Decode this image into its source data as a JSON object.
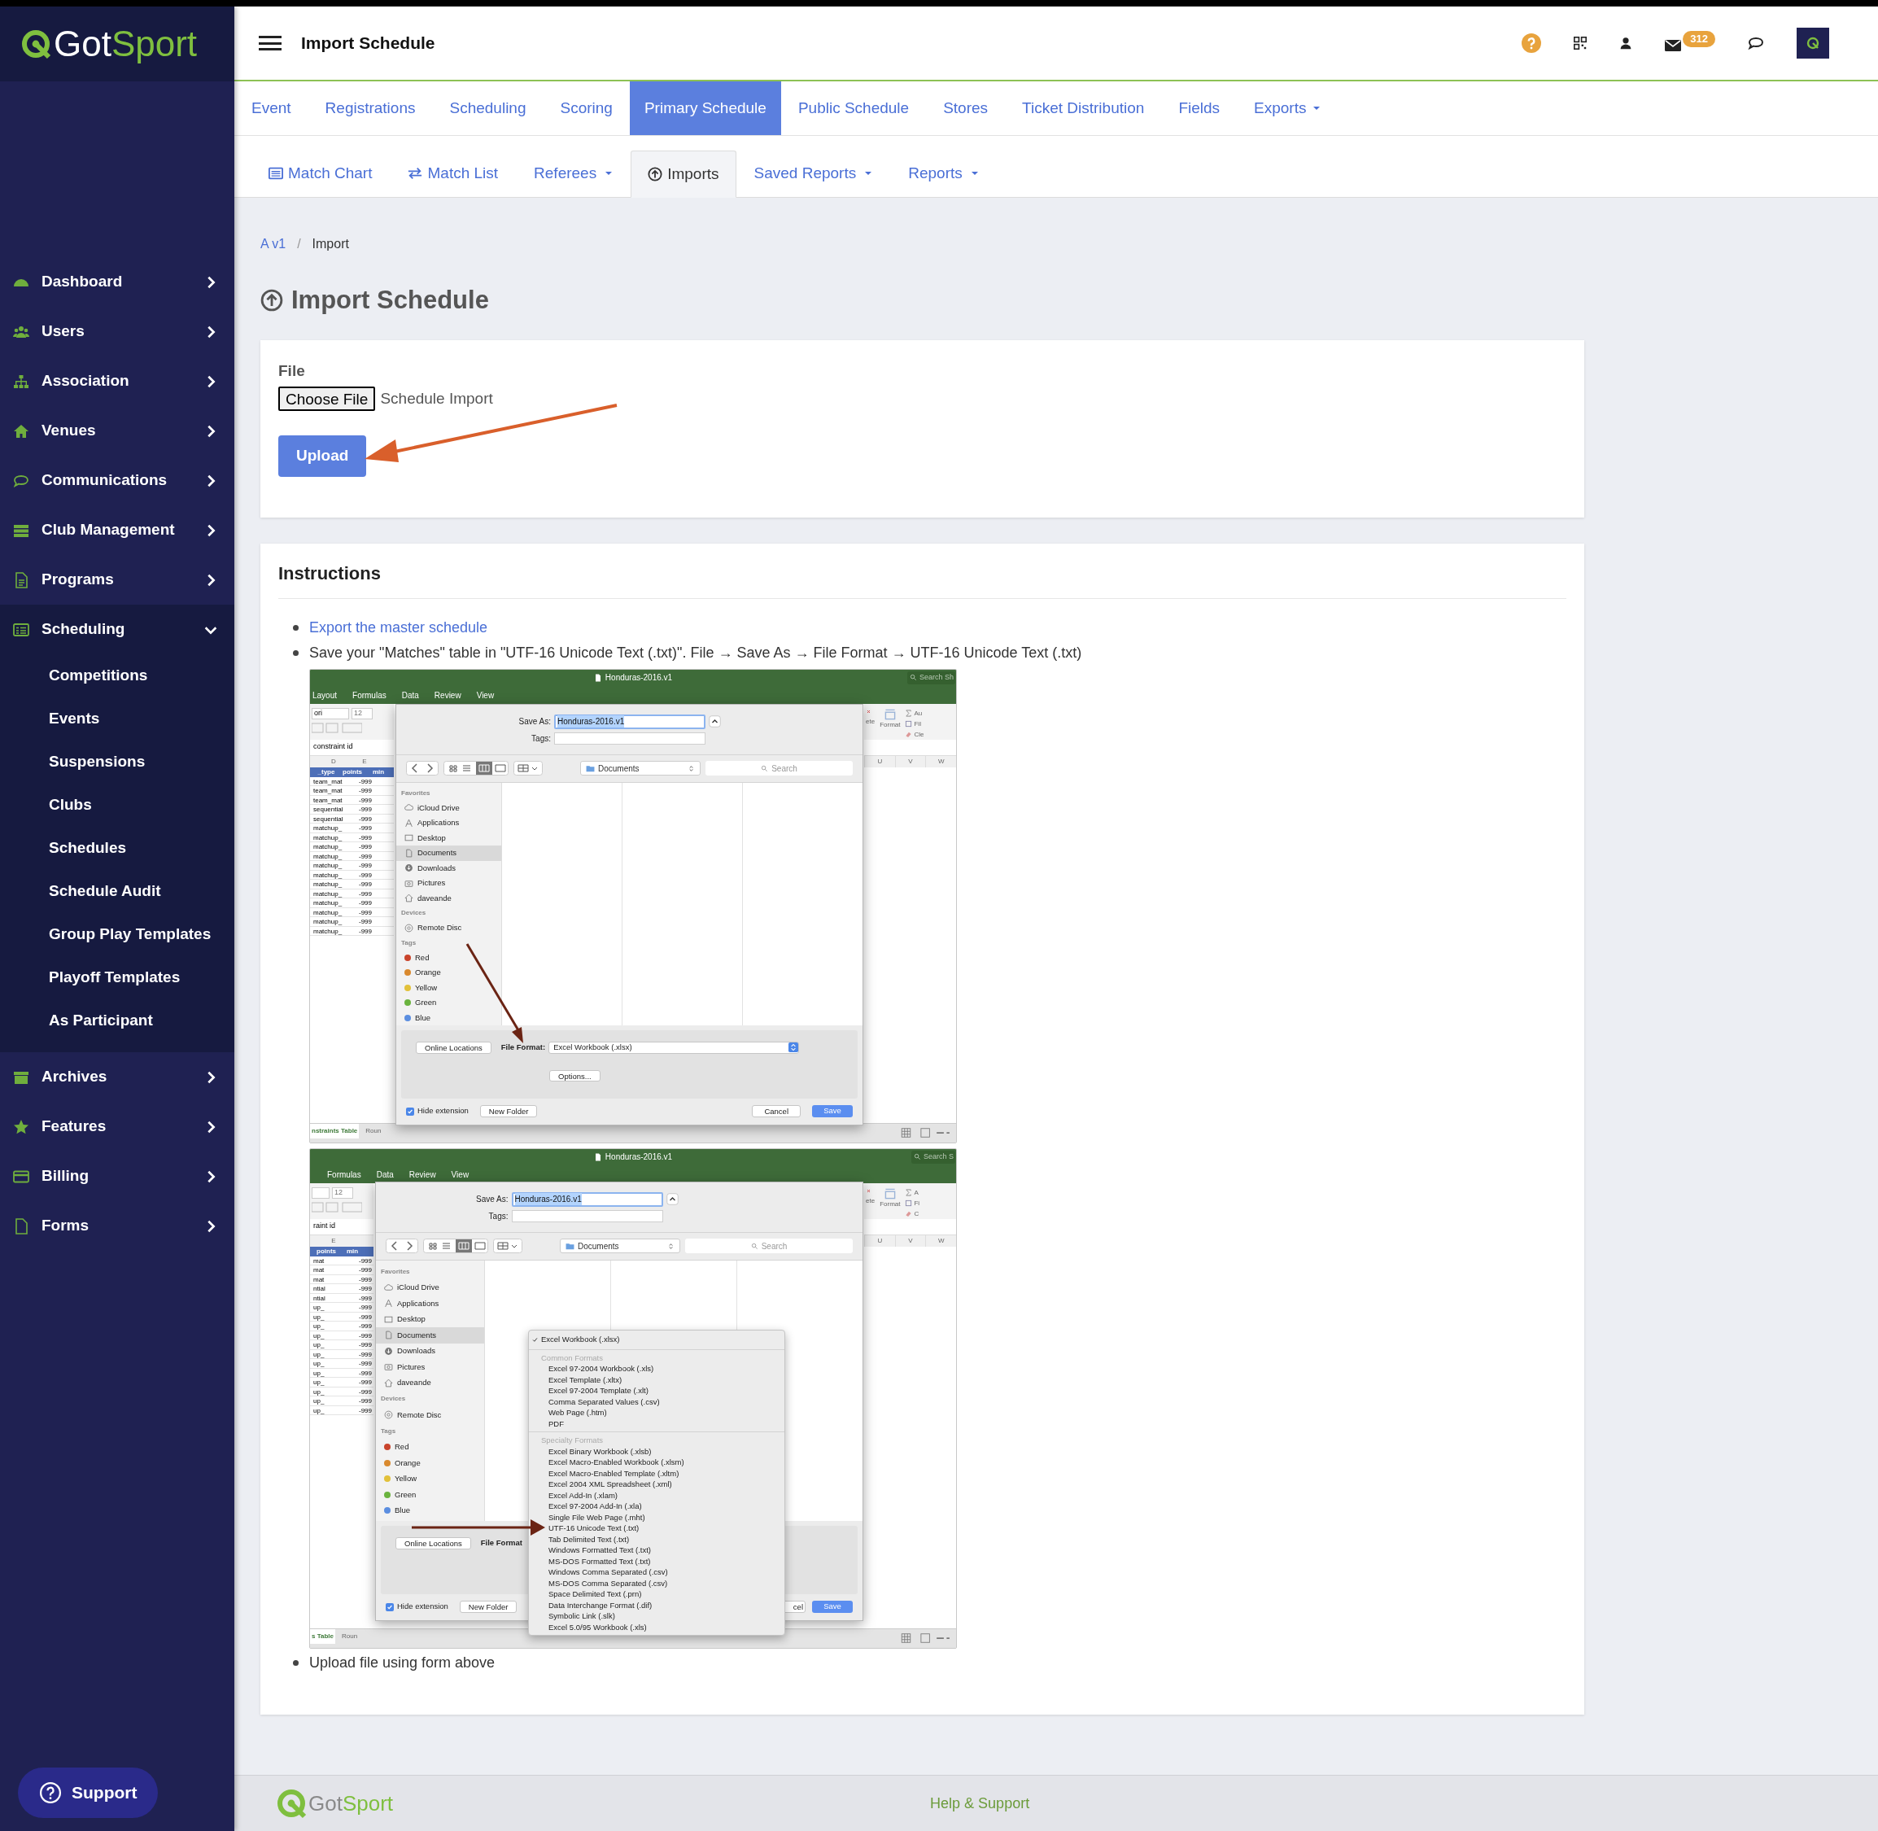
{
  "logo": {
    "part_1": "Got",
    "part_2": "Sport"
  },
  "header": {
    "title": "Import Schedule",
    "mail_count": "312"
  },
  "sidebar": {
    "items": [
      {
        "label": "Dashboard",
        "expanded": false
      },
      {
        "label": "Users",
        "expanded": false
      },
      {
        "label": "Association",
        "expanded": false
      },
      {
        "label": "Venues",
        "expanded": false
      },
      {
        "label": "Communications",
        "expanded": false
      },
      {
        "label": "Club Management",
        "expanded": false
      },
      {
        "label": "Programs",
        "expanded": false
      },
      {
        "label": "Scheduling",
        "expanded": true,
        "children": [
          {
            "label": "Competitions"
          },
          {
            "label": "Events"
          },
          {
            "label": "Suspensions"
          },
          {
            "label": "Clubs"
          },
          {
            "label": "Schedules"
          },
          {
            "label": "Schedule Audit"
          },
          {
            "label": "Group Play Templates"
          },
          {
            "label": "Playoff Templates"
          },
          {
            "label": "As Participant"
          }
        ]
      },
      {
        "label": "Archives",
        "expanded": false
      },
      {
        "label": "Features",
        "expanded": false
      },
      {
        "label": "Billing",
        "expanded": false
      },
      {
        "label": "Forms",
        "expanded": false
      }
    ],
    "support_button": "Support"
  },
  "main_tabs": [
    {
      "label": "Event",
      "selected": false,
      "dropdown": false
    },
    {
      "label": "Registrations",
      "selected": false,
      "dropdown": false
    },
    {
      "label": "Scheduling",
      "selected": false,
      "dropdown": false
    },
    {
      "label": "Scoring",
      "selected": false,
      "dropdown": false
    },
    {
      "label": "Primary Schedule",
      "selected": true,
      "dropdown": false
    },
    {
      "label": "Public Schedule",
      "selected": false,
      "dropdown": false
    },
    {
      "label": "Stores",
      "selected": false,
      "dropdown": false
    },
    {
      "label": "Ticket Distribution",
      "selected": false,
      "dropdown": false
    },
    {
      "label": "Fields",
      "selected": false,
      "dropdown": false
    },
    {
      "label": "Exports",
      "selected": false,
      "dropdown": true
    }
  ],
  "sub_tabs": [
    {
      "label": "Match Chart",
      "selected": false,
      "dropdown": false
    },
    {
      "label": "Match List",
      "selected": false,
      "dropdown": false
    },
    {
      "label": "Referees",
      "selected": false,
      "dropdown": true
    },
    {
      "label": "Imports",
      "selected": true,
      "dropdown": false
    },
    {
      "label": "Saved Reports",
      "selected": false,
      "dropdown": true
    },
    {
      "label": "Reports",
      "selected": false,
      "dropdown": true
    }
  ],
  "breadcrumb": [
    {
      "label": "A v1",
      "kind": "link"
    },
    {
      "label": "/",
      "kind": "separator"
    },
    {
      "label": "Import",
      "kind": "current"
    }
  ],
  "page_title": "Import Schedule",
  "upload_form": {
    "label": "File",
    "choose_button": "Choose File",
    "file_name": "Schedule Import",
    "submit_button": "Upload"
  },
  "instructions": {
    "heading": "Instructions",
    "steps": [
      {
        "kind": "link",
        "text": "Export the master schedule"
      },
      {
        "kind": "text",
        "text": "Save your \"Matches\" table in \"UTF-16 Unicode Text (.txt)\". File → Save As → File Format → UTF-16 Unicode Text (.txt)",
        "screenshots": [
          {
            "kind": "save-dialog",
            "window_title": "Honduras-2016.v1",
            "search": "Search Sh",
            "ribbon_tabs": [
              "Layout",
              "Formulas",
              "Data",
              "Review",
              "View"
            ],
            "font_name": "ori",
            "font_size": "12",
            "formula": "constraint id",
            "columns_left": [
              "D",
              "E"
            ],
            "header_cells": [
              "_type",
              "points",
              "min"
            ],
            "rows": [
              [
                "team_mat",
                "-999"
              ],
              [
                "team_mat",
                "-999"
              ],
              [
                "team_mat",
                "-999"
              ],
              [
                "sequential",
                "-999"
              ],
              [
                "sequential",
                "-999"
              ],
              [
                "matchup_",
                "-999"
              ],
              [
                "matchup_",
                "-999"
              ],
              [
                "matchup_",
                "-999"
              ],
              [
                "matchup_",
                "-999"
              ],
              [
                "matchup_",
                "-999"
              ],
              [
                "matchup_",
                "-999"
              ],
              [
                "matchup_",
                "-999"
              ],
              [
                "matchup_",
                "-999"
              ],
              [
                "matchup_",
                "-999"
              ],
              [
                "matchup_",
                "-999"
              ],
              [
                "matchup_",
                "-999"
              ],
              [
                "matchup_",
                "-999"
              ]
            ],
            "ribbon_right": [
              "ete",
              "Format",
              "Au",
              "Fil",
              "Cle"
            ],
            "columns_right": [
              "U",
              "V",
              "W"
            ],
            "sheet_tabs": [
              "nstraints Table",
              "Roun"
            ],
            "dialog": {
              "save_as_label": "Save As:",
              "file_name": "Honduras-2016.v1",
              "tags_label": "Tags:",
              "location": "Documents",
              "search_placeholder": "Search",
              "sections": [
                {
                  "title": "Favorites",
                  "items": [
                    {
                      "label": "iCloud Drive",
                      "selected": false
                    },
                    {
                      "label": "Applications",
                      "selected": false
                    },
                    {
                      "label": "Desktop",
                      "selected": false
                    },
                    {
                      "label": "Documents",
                      "selected": true
                    },
                    {
                      "label": "Downloads",
                      "selected": false
                    },
                    {
                      "label": "Pictures",
                      "selected": false
                    },
                    {
                      "label": "daveande",
                      "selected": false
                    }
                  ]
                },
                {
                  "title": "Devices",
                  "items": [
                    {
                      "label": "Remote Disc",
                      "selected": false
                    }
                  ]
                },
                {
                  "title": "Tags",
                  "items": [
                    {
                      "label": "Red",
                      "color": "#c9442c"
                    },
                    {
                      "label": "Orange",
                      "color": "#d9892e"
                    },
                    {
                      "label": "Yellow",
                      "color": "#e2c13a"
                    },
                    {
                      "label": "Green",
                      "color": "#6ab33e"
                    },
                    {
                      "label": "Blue",
                      "color": "#5b8ee0"
                    }
                  ]
                }
              ],
              "online_locations": "Online Locations",
              "file_format_label": "File Format:",
              "file_format": "Excel Workbook (.xlsx)",
              "options_button": "Options...",
              "hide_extension": {
                "label": "Hide extension",
                "checked": true
              },
              "new_folder": "New Folder",
              "cancel": "Cancel",
              "save": "Save"
            }
          },
          {
            "kind": "format-menu",
            "window_title": "Honduras-2016.v1",
            "search": "Search S",
            "ribbon_tabs": [
              "Formulas",
              "Data",
              "Review",
              "View"
            ],
            "font_size": "12",
            "formula": "raint id",
            "columns_left": [
              "E"
            ],
            "header_cells": [
              "points",
              "min"
            ],
            "rows": [
              [
                "mat",
                "-999"
              ],
              [
                "mat",
                "-999"
              ],
              [
                "mat",
                "-999"
              ],
              [
                "ntial",
                "-999"
              ],
              [
                "ntial",
                "-999"
              ],
              [
                "up_",
                "-999"
              ],
              [
                "up_",
                "-999"
              ],
              [
                "up_",
                "-999"
              ],
              [
                "up_",
                "-999"
              ],
              [
                "up_",
                "-999"
              ],
              [
                "up_",
                "-999"
              ],
              [
                "up_",
                "-999"
              ],
              [
                "up_",
                "-999"
              ],
              [
                "up_",
                "-999"
              ],
              [
                "up_",
                "-999"
              ],
              [
                "up_",
                "-999"
              ],
              [
                "up_",
                "-999"
              ]
            ],
            "ribbon_right": [
              "ete",
              "Format",
              "A",
              "Fi",
              "C"
            ],
            "columns_right": [
              "U",
              "V",
              "W"
            ],
            "sheet_tabs": [
              "s Table",
              "Roun"
            ],
            "dialog": {
              "save_as_label": "Save As:",
              "file_name": "Honduras-2016.v1",
              "tags_label": "Tags:",
              "location": "Documents",
              "search_placeholder": "Search",
              "sections": [
                {
                  "title": "Favorites",
                  "items": [
                    {
                      "label": "iCloud Drive",
                      "selected": false
                    },
                    {
                      "label": "Applications",
                      "selected": false
                    },
                    {
                      "label": "Desktop",
                      "selected": false
                    },
                    {
                      "label": "Documents",
                      "selected": true
                    },
                    {
                      "label": "Downloads",
                      "selected": false
                    },
                    {
                      "label": "Pictures",
                      "selected": false
                    },
                    {
                      "label": "daveande",
                      "selected": false
                    }
                  ]
                },
                {
                  "title": "Devices",
                  "items": [
                    {
                      "label": "Remote Disc",
                      "selected": false
                    }
                  ]
                },
                {
                  "title": "Tags",
                  "items": [
                    {
                      "label": "Red",
                      "color": "#c9442c"
                    },
                    {
                      "label": "Orange",
                      "color": "#d9892e"
                    },
                    {
                      "label": "Yellow",
                      "color": "#e2c13a"
                    },
                    {
                      "label": "Green",
                      "color": "#6ab33e"
                    },
                    {
                      "label": "Blue",
                      "color": "#5b8ee0"
                    }
                  ]
                }
              ],
              "online_locations": "Online Locations",
              "file_format_label": "File Format",
              "hide_extension": {
                "label": "Hide extension",
                "checked": true
              },
              "new_folder": "New Folder",
              "cancel": "cel",
              "save": "Save"
            },
            "format_menu": {
              "current": {
                "label": "Excel Workbook (.xlsx)",
                "checked": true
              },
              "groups": [
                {
                  "title": "Common Formats",
                  "items": [
                    "Excel 97-2004 Workbook (.xls)",
                    "Excel Template (.xltx)",
                    "Excel 97-2004 Template (.xlt)",
                    "Comma Separated Values (.csv)",
                    "Web Page (.htm)",
                    "PDF"
                  ]
                },
                {
                  "title": "Specialty Formats",
                  "items": [
                    "Excel Binary Workbook (.xlsb)",
                    "Excel Macro-Enabled Workbook (.xlsm)",
                    "Excel Macro-Enabled Template (.xltm)",
                    "Excel 2004 XML Spreadsheet (.xml)",
                    "Excel Add-In (.xlam)",
                    "Excel 97-2004 Add-In (.xla)",
                    "Single File Web Page (.mht)",
                    "UTF-16 Unicode Text (.txt)",
                    "Tab Delimited Text (.txt)",
                    "Windows Formatted Text (.txt)",
                    "MS-DOS Formatted Text (.txt)",
                    "Windows Comma Separated (.csv)",
                    "MS-DOS Comma Separated (.csv)",
                    "Space Delimited Text (.prn)",
                    "Data Interchange Format (.dif)",
                    "Symbolic Link (.slk)",
                    "Excel 5.0/95 Workbook (.xls)"
                  ]
                }
              ]
            }
          }
        ]
      },
      {
        "kind": "text",
        "text": "Upload file using form above"
      }
    ]
  },
  "footer": {
    "logo": {
      "part_1": "Got",
      "part_2": "Sport"
    },
    "link": "Help & Support"
  }
}
